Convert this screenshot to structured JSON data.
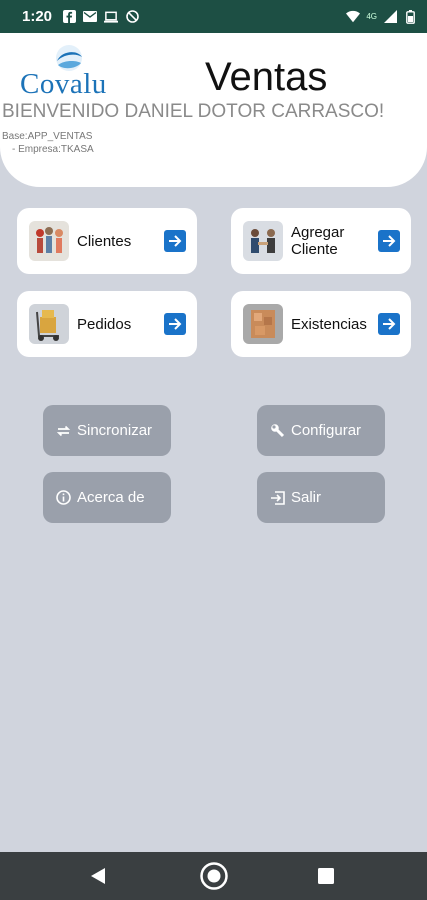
{
  "status_bar": {
    "time": "1:20",
    "network_label": "4G"
  },
  "header": {
    "logo_text": "Covalu",
    "title": "Ventas",
    "welcome": "BIENVENIDO DANIEL DOTOR CARRASCO!",
    "base": "Base:APP_VENTAS",
    "empresa": "- Empresa:TKASA"
  },
  "cards": {
    "clientes": "Clientes",
    "agregar_line1": "Agregar",
    "agregar_line2": "Cliente",
    "pedidos": "Pedidos",
    "existencias": "Existencias"
  },
  "buttons": {
    "sincronizar": "Sincronizar",
    "configurar": "Configurar",
    "acerca": "Acerca de",
    "salir": "Salir"
  },
  "colors": {
    "status_bar": "#1d4f44",
    "background": "#d0d4dd",
    "accent_arrow": "#1a73c9",
    "logo": "#1c73b8",
    "button": "#9aa0ab"
  }
}
